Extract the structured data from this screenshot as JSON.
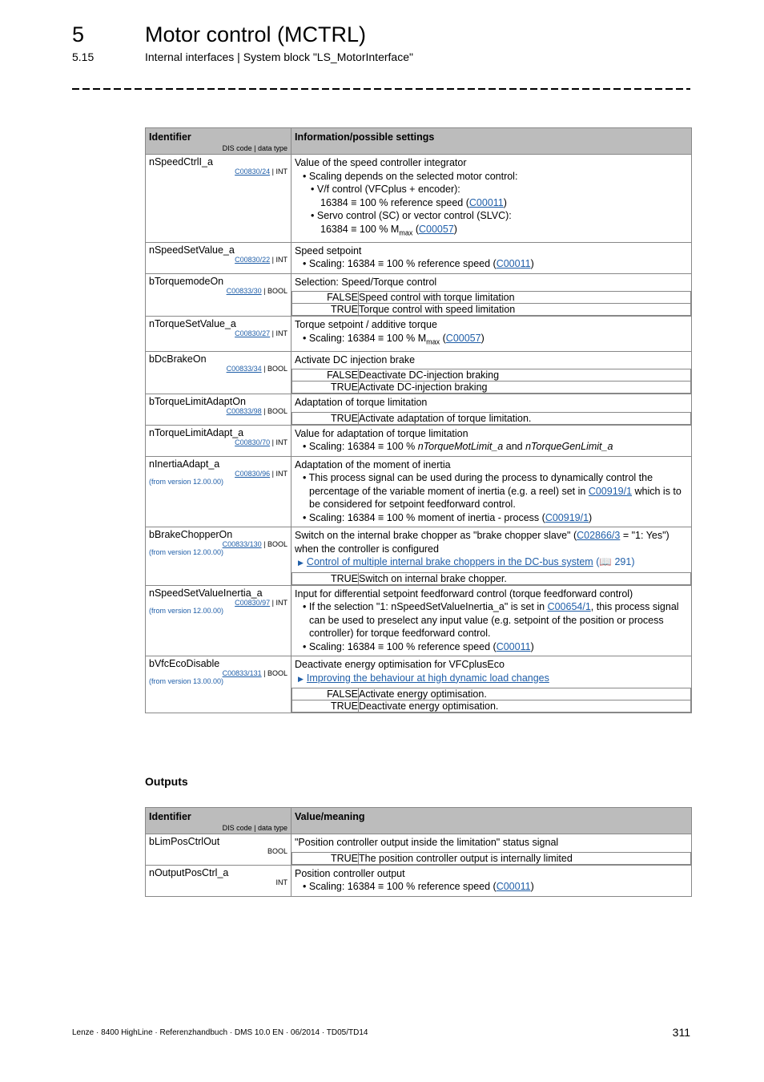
{
  "header": {
    "chapter_number": "5",
    "chapter_title": "Motor control (MCTRL)",
    "section_number": "5.15",
    "section_title": "Internal interfaces | System block \"LS_MotorInterface\""
  },
  "inputs_table": {
    "col1_header": "Identifier",
    "col1_subheader": "DIS code | data type",
    "col2_header": "Information/possible settings",
    "rows": [
      {
        "id": "nSpeedCtrlI_a",
        "code": "C00830/24",
        "type": "INT",
        "title": "Value of the speed controller integrator",
        "b1": "Scaling depends on the selected motor control:",
        "b2a": "V/f control (VFCplus + encoder):",
        "b2a_cont": "16384 ≡ 100 % reference speed (",
        "b2a_link": "C00011",
        "b2b": "Servo control (SC) or vector control (SLVC):",
        "b2b_cont": "16384 ≡ 100 % M",
        "b2b_sub": "max",
        "b2b_link": "C00057"
      },
      {
        "id": "nSpeedSetValue_a",
        "code": "C00830/22",
        "type": "INT",
        "title": "Speed setpoint",
        "b1": "Scaling: 16384 ≡ 100 % reference speed (",
        "b1_link": "C00011"
      },
      {
        "id": "bTorquemodeOn",
        "code": "C00833/30",
        "type": "BOOL",
        "title": "Selection: Speed/Torque control",
        "values": [
          {
            "key": "FALSE",
            "text": "Speed control with torque limitation"
          },
          {
            "key": "TRUE",
            "text": "Torque control with speed limitation"
          }
        ]
      },
      {
        "id": "nTorqueSetValue_a",
        "code": "C00830/27",
        "type": "INT",
        "title": "Torque setpoint / additive torque",
        "b1": "Scaling: 16384 ≡ 100 % M",
        "b1_sub": "max",
        "b1_link": "C00057"
      },
      {
        "id": "bDcBrakeOn",
        "code": "C00833/34",
        "type": "BOOL",
        "title": "Activate DC injection brake",
        "values": [
          {
            "key": "FALSE",
            "text": "Deactivate DC-injection braking"
          },
          {
            "key": "TRUE",
            "text": "Activate DC-injection braking"
          }
        ]
      },
      {
        "id": "bTorqueLimitAdaptOn",
        "code": "C00833/98",
        "type": "BOOL",
        "title": "Adaptation of torque limitation",
        "values": [
          {
            "key": "TRUE",
            "text": "Activate adaptation of torque limitation."
          }
        ]
      },
      {
        "id": "nTorqueLimitAdapt_a",
        "code": "C00830/70",
        "type": "INT",
        "title": "Value for adaptation of torque limitation",
        "b1": "Scaling: 16384 ≡ 100 % ",
        "b1_i1": "nTorqueMotLimit_a",
        "b1_and": " and ",
        "b1_i2": "nTorqueGenLimit_a"
      },
      {
        "id": "nInertiaAdapt_a",
        "code": "C00830/96",
        "type": "INT",
        "version": "(from version 12.00.00)",
        "title": "Adaptation of the moment of inertia",
        "b1": "This process signal can be used during the process to dynamically control the percentage of the variable moment of inertia (e.g. a reel) set in ",
        "b1_link": "C00919/1",
        "b1_end": " which is to be considered for setpoint feedforward control.",
        "b2": "Scaling: 16384 ≡ 100 % moment of inertia - process (",
        "b2_link": "C00919/1"
      },
      {
        "id": "bBrakeChopperOn",
        "code": "C00833/130",
        "type": "BOOL",
        "version": "(from version 12.00.00)",
        "title_a": "Switch on the internal brake chopper as \"brake chopper slave\" (",
        "title_link": "C02866/3",
        "title_b": " = \"1: Yes\") when the controller is configured",
        "xref": "Control of multiple internal brake choppers in the DC-bus system",
        "xref_page": "291",
        "values": [
          {
            "key": "TRUE",
            "text": "Switch on internal brake chopper."
          }
        ]
      },
      {
        "id": "nSpeedSetValueInertia_a",
        "code": "C00830/97",
        "type": "INT",
        "version": "(from version 12.00.00)",
        "title": "Input for differential setpoint feedforward control (torque feedforward control)",
        "b1": "If the selection \"1: nSpeedSetValueInertia_a\" is set in ",
        "b1_link": "C00654/1",
        "b1_end": ", this process signal can be used to preselect any input value (e.g. setpoint of the position or process controller) for torque feedforward control.",
        "b2": "Scaling: 16384 ≡ 100 % reference speed (",
        "b2_link": "C00011"
      },
      {
        "id": "bVfcEcoDisable",
        "code": "C00833/131",
        "type": "BOOL",
        "version": "(from version 13.00.00)",
        "title": "Deactivate energy optimisation for VFCplusEco",
        "xref": "Improving the behaviour at high dynamic load changes",
        "values": [
          {
            "key": "FALSE",
            "text": "Activate energy optimisation."
          },
          {
            "key": "TRUE",
            "text": "Deactivate energy optimisation."
          }
        ]
      }
    ]
  },
  "outputs_heading": "Outputs",
  "outputs_table": {
    "col1_header": "Identifier",
    "col1_subheader": "DIS code | data type",
    "col2_header": "Value/meaning",
    "rows": [
      {
        "id": "bLimPosCtrlOut",
        "type": "BOOL",
        "title": "\"Position controller output inside the limitation\" status signal",
        "values": [
          {
            "key": "TRUE",
            "text": "The position controller output is internally limited"
          }
        ]
      },
      {
        "id": "nOutputPosCtrl_a",
        "type": "INT",
        "title": "Position controller output",
        "b1": "Scaling: 16384 ≡ 100 % reference speed (",
        "b1_link": "C00011"
      }
    ]
  },
  "footer": {
    "text": "Lenze · 8400 HighLine · Referenzhandbuch · DMS 10.0 EN · 06/2014 · TD05/TD14",
    "page_number": "311"
  }
}
